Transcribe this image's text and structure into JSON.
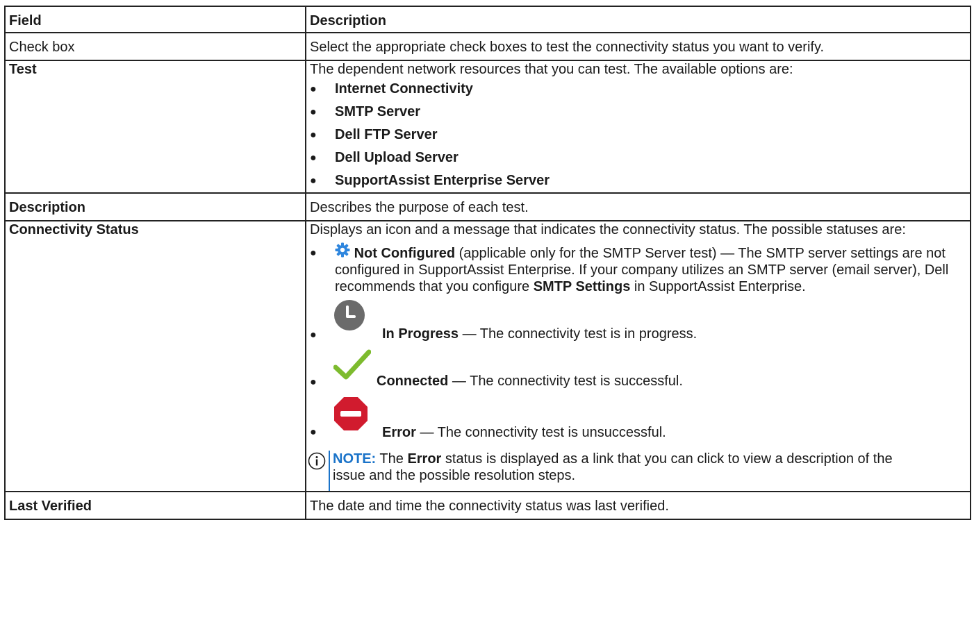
{
  "table": {
    "headers": [
      "Field",
      "Description"
    ],
    "rows": {
      "checkbox": {
        "field": "Check box",
        "description": "Select the appropriate check boxes to test the connectivity status you want to verify."
      },
      "test": {
        "field": "Test",
        "description": "The dependent network resources that you can test. The available options are:",
        "options": [
          "Internet Connectivity",
          "SMTP Server",
          "Dell FTP Server",
          "Dell Upload Server",
          "SupportAssist Enterprise Server"
        ]
      },
      "description": {
        "field": "Description",
        "description": "Describes the purpose of each test."
      },
      "connectivity": {
        "field": "Connectivity Status",
        "intro": "Displays an icon and a message that indicates the connectivity status. The possible statuses are:",
        "statuses": {
          "not_configured": {
            "icon": "gear-icon",
            "label": "Not Configured",
            "text1": " (applicable only for the SMTP Server test) — The SMTP server settings are not configured in SupportAssist Enterprise. If your company utilizes an SMTP server (email server), Dell recommends that you configure ",
            "bold2": "SMTP Settings",
            "text2": " in SupportAssist Enterprise."
          },
          "in_progress": {
            "icon": "clock-icon",
            "label": "In Progress",
            "text": " — The connectivity test is in progress."
          },
          "connected": {
            "icon": "checkmark-icon",
            "label": "Connected",
            "text": " — The connectivity test is successful."
          },
          "error": {
            "icon": "stop-icon",
            "label": "Error",
            "text": " — The connectivity test is unsuccessful."
          }
        },
        "note": {
          "label": "NOTE:",
          "pre": " The ",
          "bold": "Error",
          "post": " status is displayed as a link that you can click to view a description of the issue and the possible resolution steps."
        }
      },
      "last_verified": {
        "field": "Last Verified",
        "description": "The date and time the connectivity status was last verified."
      }
    }
  },
  "colors": {
    "note_accent": "#1a73c9",
    "gear_blue": "#2e86de",
    "clock_gray": "#6b6b6b",
    "check_green": "#7dbb2e",
    "error_red": "#d11b2e"
  }
}
